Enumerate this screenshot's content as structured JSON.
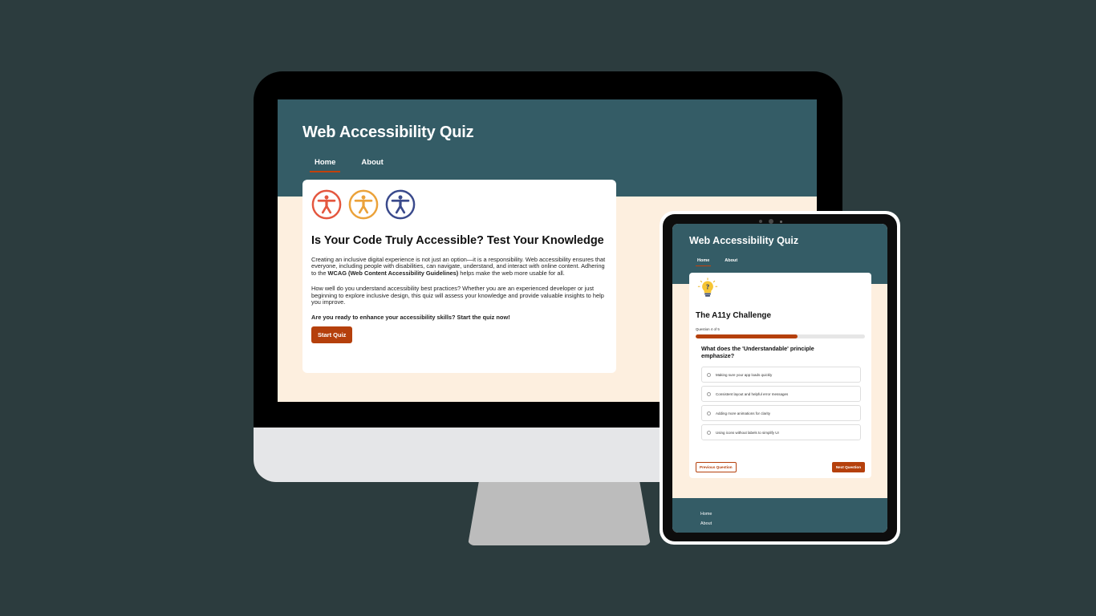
{
  "desktop": {
    "title": "Web Accessibility Quiz",
    "nav": [
      {
        "label": "Home",
        "active": true
      },
      {
        "label": "About",
        "active": false
      }
    ],
    "icons": [
      {
        "name": "accessibility-icon-red",
        "color": "#e4573f"
      },
      {
        "name": "accessibility-icon-orange",
        "color": "#eba23a"
      },
      {
        "name": "accessibility-icon-blue",
        "color": "#3a4a8c"
      }
    ],
    "heading": "Is Your Code Truly Accessible? Test Your Knowledge",
    "p1_before": "Creating an inclusive digital experience is not just an option—it is a responsibility. Web accessibility ensures that everyone, including people with disabilities, can navigate, understand, and interact with online content. Adhering to the ",
    "p1_bold": "WCAG (Web Content Accessibility Guidelines)",
    "p1_after": " helps make the web more usable for all.",
    "p2": "How well do you understand accessibility best practices? Whether you are an experienced developer or just beginning to explore inclusive design, this quiz will assess your knowledge and provide valuable insights to help you improve.",
    "p3": "Are you ready to enhance your accessibility skills? Start the quiz now!",
    "start_button": "Start Quiz"
  },
  "tablet": {
    "title": "Web Accessibility Quiz",
    "nav": [
      {
        "label": "Home",
        "active": true
      },
      {
        "label": "About",
        "active": false
      }
    ],
    "icon": "lightbulb-question-icon",
    "card_title": "The A11y Challenge",
    "progress_label": "Question 4 of 5",
    "progress_fraction": 0.6,
    "question": "What does the 'Understandable' principle emphasize?",
    "options": [
      "Making sure your app loads quickly",
      "Consistent layout and helpful error messages",
      "Adding more animations for clarity",
      "Using icons without labels to simplify UI"
    ],
    "prev_button": "Previous Question",
    "next_button": "Next Question",
    "footer_links": [
      "Home",
      "About"
    ]
  },
  "colors": {
    "background": "#2c3c3e",
    "header": "#345c66",
    "page": "#fdefdf",
    "accent": "#b5400c"
  }
}
